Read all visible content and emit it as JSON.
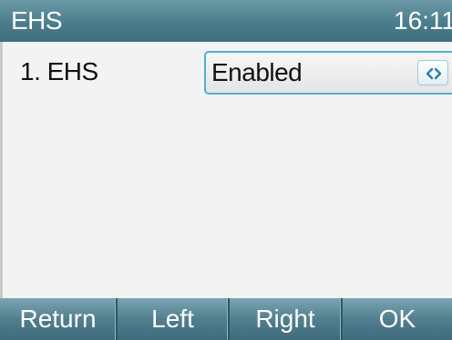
{
  "status_bar": {
    "title": "EHS",
    "time": "16:11"
  },
  "settings": {
    "items": [
      {
        "label": "1. EHS",
        "value": "Enabled",
        "control_icon": "left-right-arrows-icon"
      }
    ],
    "accent_color": "#4fb0cf"
  },
  "softkeys": [
    {
      "label": "Return"
    },
    {
      "label": "Left"
    },
    {
      "label": "Right"
    },
    {
      "label": "OK"
    }
  ],
  "colors": {
    "header": "#4b7d8c",
    "softkey_bar": "#527f8f",
    "background": "#f3f3f3"
  }
}
